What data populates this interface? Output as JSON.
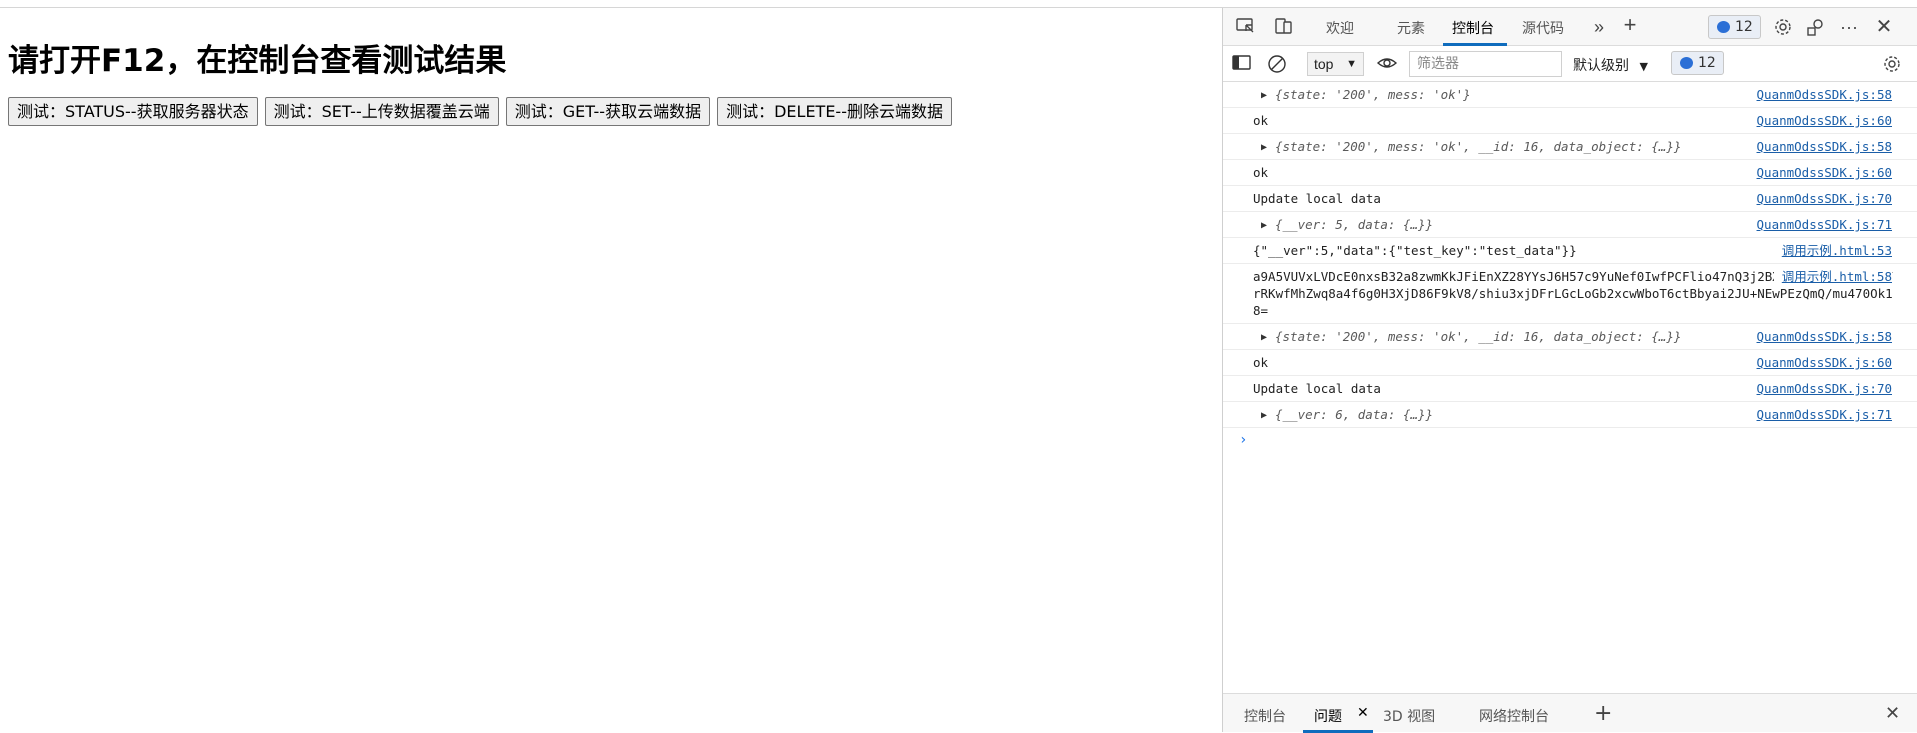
{
  "page": {
    "heading": "请打开F12，在控制台查看测试结果",
    "buttons": [
      {
        "label": "测试：STATUS--获取服务器状态"
      },
      {
        "label": "测试：SET--上传数据覆盖云端"
      },
      {
        "label": "测试：GET--获取云端数据"
      },
      {
        "label": "测试：DELETE--删除云端数据"
      }
    ]
  },
  "devtools": {
    "tabs": [
      {
        "label": "欢迎"
      },
      {
        "label": "元素"
      },
      {
        "label": "控制台"
      },
      {
        "label": "源代码"
      }
    ],
    "active_tab": "控制台",
    "issues_count": "12",
    "context": "top",
    "filter_placeholder": "筛选器",
    "log_level": "默认级别",
    "icons": [
      "inspect-icon",
      "device-icon",
      "more-tabs-icon",
      "add-tab-icon",
      "settings-icon",
      "dock-icon",
      "more-icon",
      "close-icon",
      "sidebar-icon",
      "clear-icon",
      "eye-icon",
      "gear-icon"
    ],
    "colors": {
      "accent": "#0f6cbd",
      "link": "#1a5ea8",
      "badge_bubble": "#2b6fd6"
    },
    "console": [
      {
        "type": "obj",
        "text": "{state: '200', mess: 'ok'}",
        "source": "QuanmOdssSDK.js:58"
      },
      {
        "type": "log",
        "text": "ok",
        "source": "QuanmOdssSDK.js:60"
      },
      {
        "type": "obj",
        "text": "{state: '200', mess: 'ok', __id: 16, data_object: {…}}",
        "source": "QuanmOdssSDK.js:58"
      },
      {
        "type": "log",
        "text": "ok",
        "source": "QuanmOdssSDK.js:60"
      },
      {
        "type": "log",
        "text": "Update local data",
        "source": "QuanmOdssSDK.js:70"
      },
      {
        "type": "obj",
        "text": "{__ver: 5, data: {…}}",
        "source": "QuanmOdssSDK.js:71"
      },
      {
        "type": "log",
        "text": "{\"__ver\":5,\"data\":{\"test_key\":\"test_data\"}}",
        "source": "调用示例.html:53"
      },
      {
        "type": "wrap",
        "text": "a9A5VUVxLVDcE0nxsB32a8zwmKkJFiEnXZ28YYsJ6H57c9YuNef0IwfPCFlio47nQ3j2BXf69mPeF8tNInZ9TrRKwfMhZwq8a4f6g0H3XjD86F9kV8/shiu3xjDFrLGcLoGb2xcwWboT6ctBbyai2JU+NEwPEzQmQ/mu470Ok18=",
        "source": "调用示例.html:58"
      },
      {
        "type": "obj",
        "text": "{state: '200', mess: 'ok', __id: 16, data_object: {…}}",
        "source": "QuanmOdssSDK.js:58"
      },
      {
        "type": "log",
        "text": "ok",
        "source": "QuanmOdssSDK.js:60"
      },
      {
        "type": "log",
        "text": "Update local data",
        "source": "QuanmOdssSDK.js:70"
      },
      {
        "type": "obj",
        "text": "{__ver: 6, data: {…}}",
        "source": "QuanmOdssSDK.js:71"
      }
    ],
    "drawer_tabs": [
      {
        "label": "控制台"
      },
      {
        "label": "问题"
      },
      {
        "label": "3D 视图"
      },
      {
        "label": "网络控制台"
      }
    ],
    "drawer_active": "问题"
  }
}
